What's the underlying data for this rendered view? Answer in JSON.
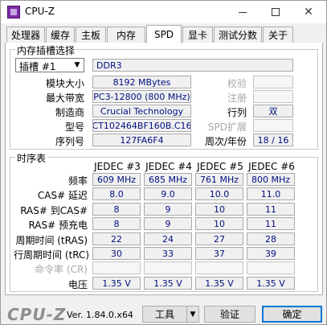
{
  "window": {
    "title": "CPU-Z",
    "controls": {
      "minimize": "—",
      "maximize": "□",
      "close": "✕"
    }
  },
  "tabs": [
    {
      "label": "处理器"
    },
    {
      "label": "缓存"
    },
    {
      "label": "主板"
    },
    {
      "label": "内存"
    },
    {
      "label": "SPD",
      "active": true
    },
    {
      "label": "显卡"
    },
    {
      "label": "测试分数"
    },
    {
      "label": "关于"
    }
  ],
  "slot_group": {
    "title": "内存插槽选择",
    "selected_slot": "插槽 #1",
    "memory_type": "DDR3",
    "fields": {
      "module_size_label": "模块大小",
      "module_size": "8192 MBytes",
      "max_bandwidth_label": "最大带宽",
      "max_bandwidth": "PC3-12800 (800 MHz)",
      "manufacturer_label": "制造商",
      "manufacturer": "Crucial Technology",
      "part_number_label": "型号",
      "part_number": "CT102464BF160B.C16",
      "serial_label": "序列号",
      "serial": "127FA6F4",
      "correction_label": "校验",
      "registered_label": "注册",
      "ranks_label": "行列",
      "ranks": "双",
      "spd_ext_label": "SPD扩展",
      "week_year_label": "周次/年份",
      "week_year": "18 / 16"
    }
  },
  "timing_group": {
    "title": "时序表",
    "columns": [
      "JEDEC #3",
      "JEDEC #4",
      "JEDEC #5",
      "JEDEC #6"
    ],
    "rows": [
      {
        "label": "频率",
        "values": [
          "609 MHz",
          "685 MHz",
          "761 MHz",
          "800 MHz"
        ]
      },
      {
        "label": "CAS# 延迟",
        "values": [
          "8.0",
          "9.0",
          "10.0",
          "11.0"
        ]
      },
      {
        "label": "RAS# 到CAS#",
        "values": [
          "8",
          "9",
          "10",
          "11"
        ]
      },
      {
        "label": "RAS# 预充电",
        "values": [
          "8",
          "9",
          "10",
          "11"
        ]
      },
      {
        "label": "周期时间 (tRAS)",
        "values": [
          "22",
          "24",
          "27",
          "28"
        ]
      },
      {
        "label": "行周期时间 (tRC)",
        "values": [
          "30",
          "33",
          "37",
          "39"
        ]
      },
      {
        "label": "命令率 (CR)",
        "values": [
          "",
          "",
          "",
          ""
        ],
        "disabled": true
      },
      {
        "label": "电压",
        "values": [
          "1.35 V",
          "1.35 V",
          "1.35 V",
          "1.35 V"
        ]
      }
    ]
  },
  "footer": {
    "brand": "CPU-Z",
    "version": "Ver. 1.84.0.x64",
    "tools_label": "工具",
    "validate_label": "验证",
    "ok_label": "确定"
  }
}
